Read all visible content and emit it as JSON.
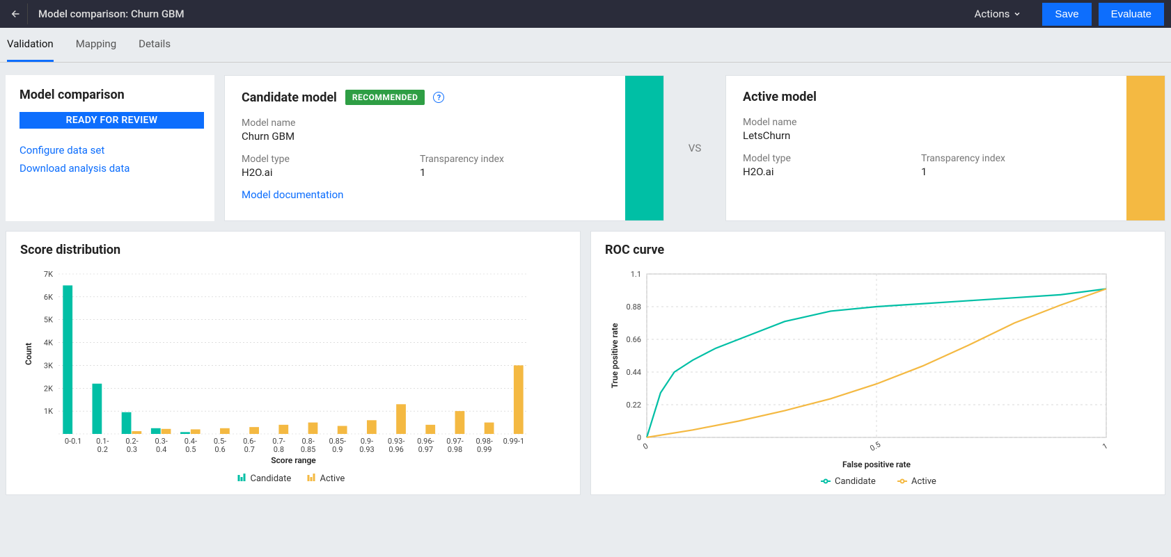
{
  "header": {
    "title": "Model comparison: Churn GBM",
    "actions_label": "Actions",
    "save_label": "Save",
    "evaluate_label": "Evaluate"
  },
  "tabs": [
    {
      "label": "Validation",
      "active": true
    },
    {
      "label": "Mapping",
      "active": false
    },
    {
      "label": "Details",
      "active": false
    }
  ],
  "sidebar": {
    "title": "Model comparison",
    "status": "READY FOR REVIEW",
    "links": [
      {
        "label": "Configure data set"
      },
      {
        "label": "Download analysis data"
      }
    ],
    "vs_label": "VS"
  },
  "candidate": {
    "heading": "Candidate model",
    "badge": "RECOMMENDED",
    "name_label": "Model name",
    "name": "Churn GBM",
    "type_label": "Model type",
    "type": "H2O.ai",
    "transp_label": "Transparency index",
    "transp": "1",
    "doc_link": "Model documentation",
    "accent": "#00bfa5"
  },
  "active": {
    "heading": "Active model",
    "name_label": "Model name",
    "name": "LetsChurn",
    "type_label": "Model type",
    "type": "H2O.ai",
    "transp_label": "Transparency index",
    "transp": "1",
    "accent": "#f4b942"
  },
  "chart_data": [
    {
      "type": "bar",
      "title": "Score distribution",
      "xlabel": "Score range",
      "ylabel": "Count",
      "categories": [
        "0-0.1",
        "0.1-0.2",
        "0.2-0.3",
        "0.3-0.4",
        "0.4-0.5",
        "0.5-0.6",
        "0.6-0.7",
        "0.7-0.8",
        "0.8-0.85",
        "0.85-0.9",
        "0.9-0.93",
        "0.93-0.96",
        "0.96-0.97",
        "0.97-0.98",
        "0.98-0.99",
        "0.99-1"
      ],
      "series": [
        {
          "name": "Candidate",
          "color": "#00bfa5",
          "values": [
            6500,
            2200,
            950,
            250,
            80,
            0,
            0,
            0,
            0,
            0,
            0,
            0,
            0,
            0,
            0,
            0
          ]
        },
        {
          "name": "Active",
          "color": "#f4b942",
          "values": [
            0,
            0,
            120,
            220,
            200,
            250,
            300,
            400,
            500,
            350,
            600,
            1300,
            400,
            1000,
            500,
            3000
          ]
        }
      ],
      "ylim": [
        0,
        7000
      ],
      "yticks": [
        0,
        1000,
        2000,
        3000,
        4000,
        5000,
        6000,
        7000
      ],
      "ytick_labels": [
        "",
        "1K",
        "2K",
        "3K",
        "4K",
        "5K",
        "6K",
        "7K"
      ]
    },
    {
      "type": "line",
      "title": "ROC curve",
      "xlabel": "False positive rate",
      "ylabel": "True positive rate",
      "xlim": [
        0,
        1
      ],
      "ylim": [
        0,
        1.1
      ],
      "xticks": [
        0,
        0.5,
        1
      ],
      "xtick_labels": [
        "0",
        "0.5",
        "1"
      ],
      "yticks": [
        0,
        0.22,
        0.44,
        0.66,
        0.88,
        1.1
      ],
      "ytick_labels": [
        "0",
        "0.22",
        "0.44",
        "0.66",
        "0.88",
        "1.1"
      ],
      "series": [
        {
          "name": "Candidate",
          "color": "#00bfa5",
          "x": [
            0,
            0.03,
            0.06,
            0.1,
            0.15,
            0.2,
            0.3,
            0.4,
            0.5,
            0.6,
            0.7,
            0.8,
            0.9,
            1.0
          ],
          "y": [
            0,
            0.3,
            0.44,
            0.52,
            0.6,
            0.66,
            0.78,
            0.85,
            0.88,
            0.9,
            0.92,
            0.94,
            0.96,
            1.0
          ]
        },
        {
          "name": "Active",
          "color": "#f4b942",
          "x": [
            0,
            0.1,
            0.2,
            0.3,
            0.4,
            0.5,
            0.6,
            0.7,
            0.8,
            0.9,
            1.0
          ],
          "y": [
            0,
            0.05,
            0.11,
            0.18,
            0.26,
            0.36,
            0.48,
            0.62,
            0.77,
            0.89,
            1.0
          ]
        }
      ]
    }
  ]
}
